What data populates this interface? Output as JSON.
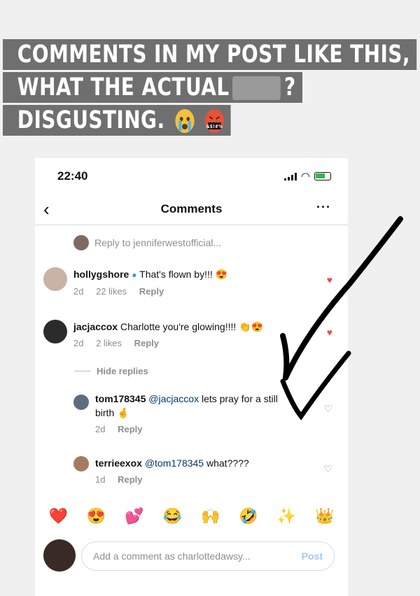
{
  "story_caption": {
    "line1": "COMMENTS IN MY POST LIKE THIS,",
    "line2_before": "WHAT THE ACTUAL",
    "line2_after": "?",
    "line3": "DISGUSTING.",
    "emoji_angry_text": "&$!#%"
  },
  "status_bar": {
    "time": "22:40"
  },
  "header": {
    "title": "Comments",
    "more": "···"
  },
  "reply_banner": {
    "text": "Reply to jenniferwestofficial..."
  },
  "comments": [
    {
      "user": "hollygshore",
      "verified": true,
      "text": "That's flown by!!! 😍",
      "age": "2d",
      "likes": "22 likes",
      "reply": "Reply"
    },
    {
      "user": "jacjaccox",
      "text": "Charlotte you're glowing!!!! 👏😍",
      "age": "2d",
      "likes": "2 likes",
      "reply": "Reply"
    }
  ],
  "hide_replies": "Hide replies",
  "replies": [
    {
      "user": "tom178345",
      "mention": "@jacjaccox",
      "text": " lets pray for a still birth 🤞",
      "age": "2d",
      "reply": "Reply"
    },
    {
      "user": "terrieexox",
      "mention": "@tom178345",
      "text": " what????",
      "age": "1d",
      "reply": "Reply"
    }
  ],
  "emoji_bar": [
    "❤️",
    "😍",
    "💕",
    "😂",
    "🙌",
    "🤣",
    "✨",
    "👑"
  ],
  "composer": {
    "placeholder": "Add a comment as charlottedawsy...",
    "post_label": "Post"
  },
  "colors": {
    "caption_bg": "#6f6f6f",
    "like_red": "#ed4956",
    "post_disabled": "#9fc9f5"
  }
}
